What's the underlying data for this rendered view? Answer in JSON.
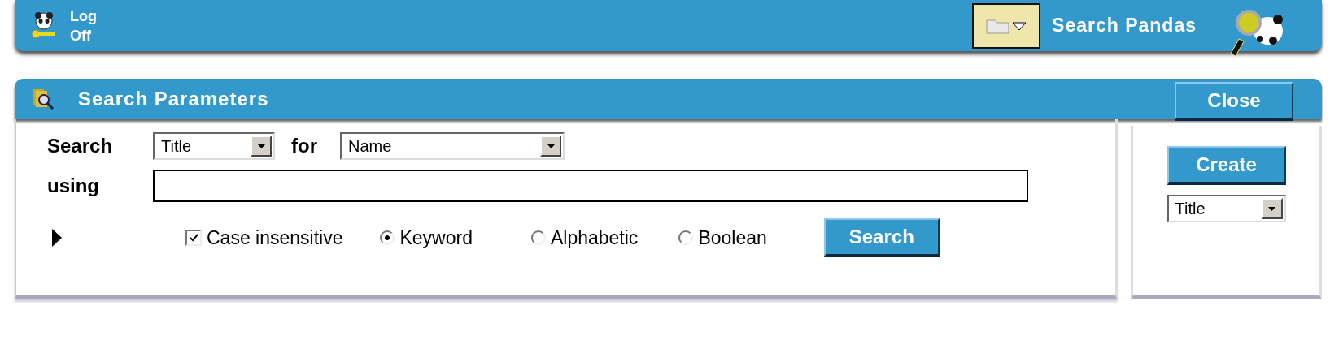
{
  "top_bar": {
    "logoff": "Log Off",
    "title": "Search Pandas"
  },
  "panel": {
    "title": "Search Parameters",
    "close": "Close"
  },
  "form": {
    "search_label": "Search",
    "field_select": "Title",
    "for_label": "for",
    "value_select": "Name",
    "using_label": "using",
    "case_insensitive": {
      "label": "Case insensitive",
      "checked": true
    },
    "modes": [
      {
        "label": "Keyword",
        "selected": true
      },
      {
        "label": "Alphabetic",
        "selected": false
      },
      {
        "label": "Boolean",
        "selected": false
      }
    ],
    "search_button": "Search"
  },
  "side": {
    "create": "Create",
    "sort_select": "Title"
  }
}
